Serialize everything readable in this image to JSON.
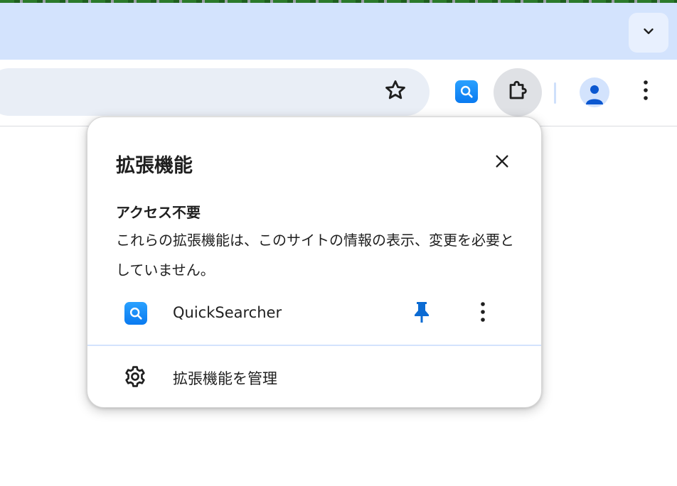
{
  "browser": {
    "tab_search_icon": "chevron-down-icon",
    "toolbar": {
      "bookmark_icon": "star-icon",
      "pinned_extension_icon": "magnifier-app-icon",
      "extensions_icon": "puzzle-icon",
      "profile_icon": "person-icon",
      "menu_icon": "kebab-menu-icon"
    }
  },
  "popup": {
    "title": "拡張機能",
    "close_icon": "close-icon",
    "section": {
      "heading": "アクセス不要",
      "description": "これらの拡張機能は、このサイトの情報の表示、変更を必要としていません。"
    },
    "extensions": [
      {
        "name": "QuickSearcher",
        "pinned": true
      }
    ],
    "manage_label": "拡張機能を管理"
  },
  "colors": {
    "tabstrip": "#d3e3fd",
    "omnibox": "#e9eef6",
    "pin_accent": "#0b6bd3",
    "app_icon": "#1a8cff"
  }
}
